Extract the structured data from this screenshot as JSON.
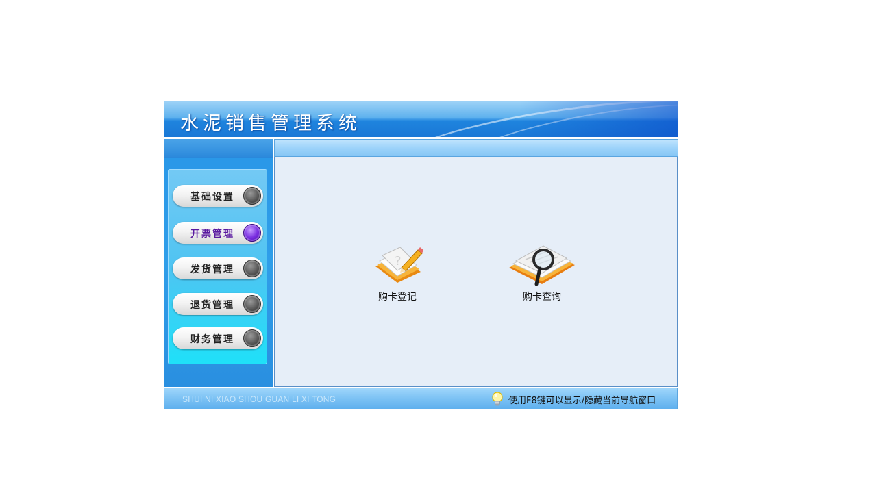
{
  "app": {
    "title": "水泥销售管理系统",
    "subtitle": "SHUI NI XIAO SHOU GUAN LI XI TONG"
  },
  "sidebar": {
    "items": [
      {
        "label": "基础设置",
        "active": false
      },
      {
        "label": "开票管理",
        "active": true
      },
      {
        "label": "发货管理",
        "active": false
      },
      {
        "label": "退货管理",
        "active": false
      },
      {
        "label": "财务管理",
        "active": false
      }
    ]
  },
  "content": {
    "shortcuts": [
      {
        "label": "购卡登记",
        "icon": "notebook-pencil-icon"
      },
      {
        "label": "购卡查询",
        "icon": "magnifier-book-icon"
      }
    ]
  },
  "footer": {
    "hint_icon": "lightbulb-icon",
    "hint": "使用F8键可以显示/隐藏当前导航窗口"
  },
  "colors": {
    "header_blue": "#1f84de",
    "sidebar_blue": "#2f9ee9",
    "content_bg": "#e6eef8",
    "active_knob": "#7a2ee0"
  }
}
